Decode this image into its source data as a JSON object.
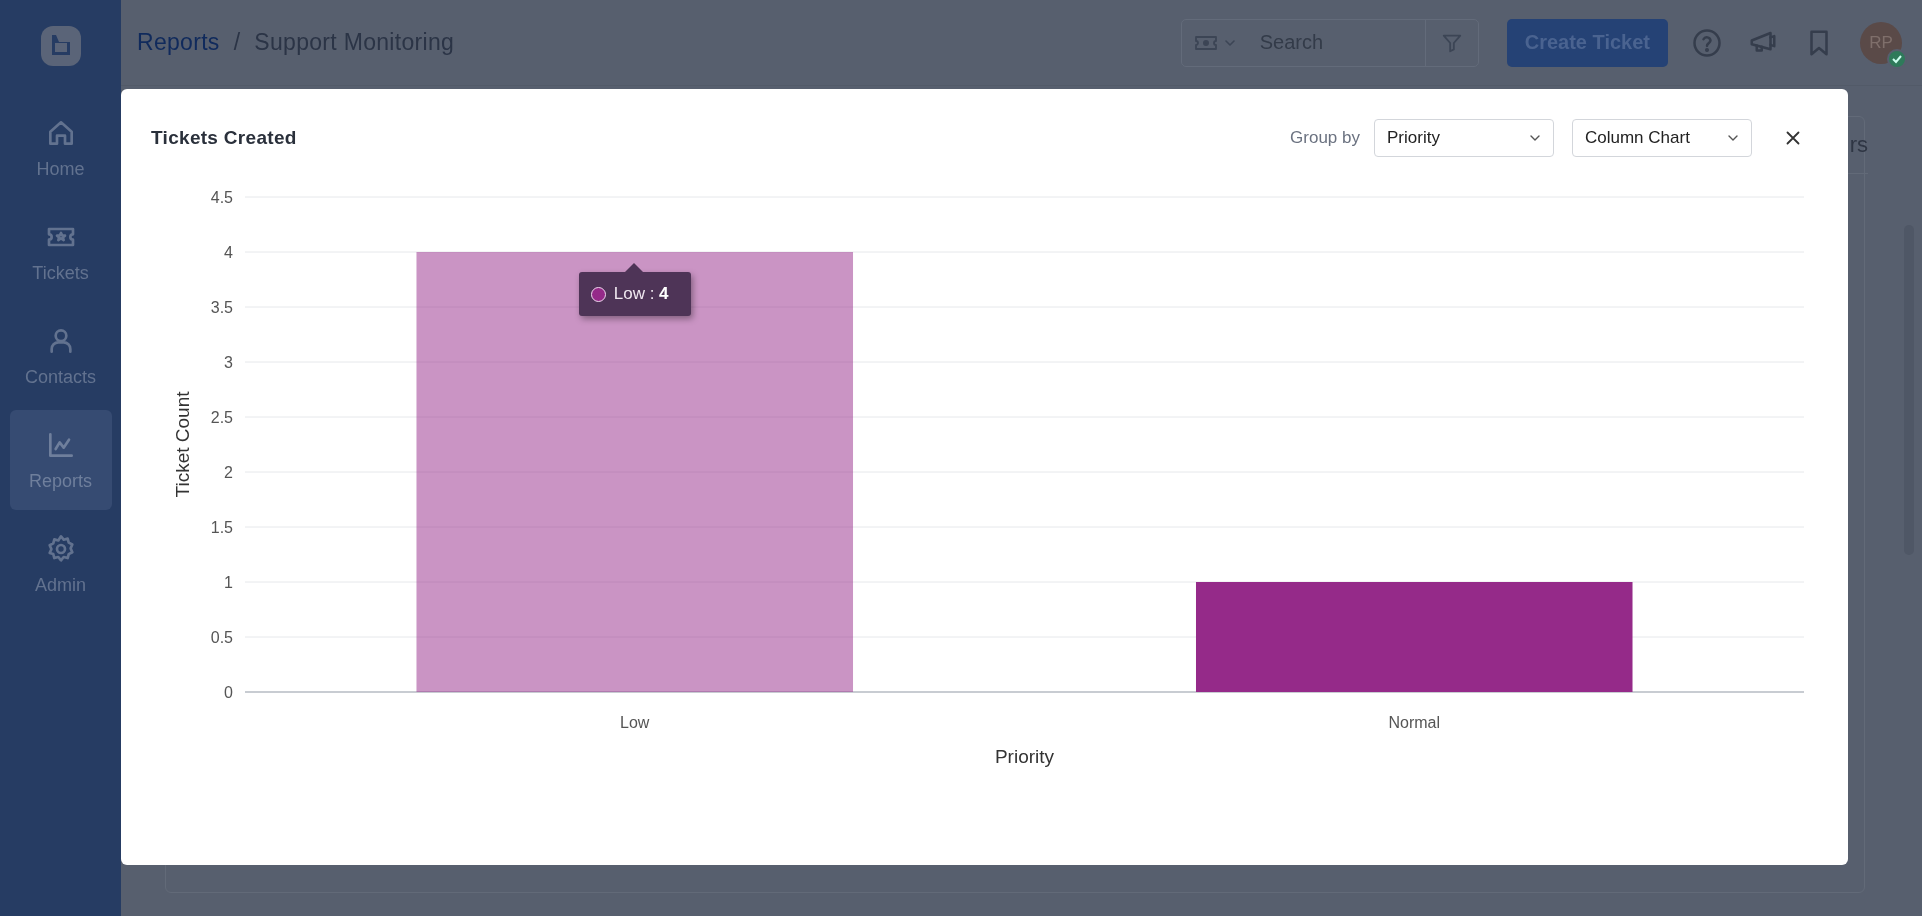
{
  "sidebar": {
    "items": [
      {
        "label": "Home",
        "selected": false
      },
      {
        "label": "Tickets",
        "selected": false
      },
      {
        "label": "Contacts",
        "selected": false
      },
      {
        "label": "Reports",
        "selected": true
      },
      {
        "label": "Admin",
        "selected": false
      }
    ]
  },
  "header": {
    "breadcrumb": [
      "Reports",
      "Support Monitoring"
    ],
    "breadcrumb_separator": "/",
    "search": {
      "placeholder": "Search"
    },
    "create_button": "Create Ticket",
    "avatar": {
      "initials": "RP",
      "online": true
    }
  },
  "background_panel": {
    "title_fragment": "rs"
  },
  "modal": {
    "title": "Tickets Created",
    "group_by_label": "Group by",
    "group_by": "Priority",
    "chart_type": "Column Chart",
    "chart_data": {
      "type": "bar",
      "orientation": "vertical",
      "xlabel": "Priority",
      "ylabel": "Ticket Count",
      "categories": [
        "Low",
        "Normal"
      ],
      "series": [
        {
          "color": "#952a89",
          "values": [
            4,
            1
          ]
        }
      ],
      "ylim": [
        0,
        4.5
      ],
      "yticks": [
        0,
        0.5,
        1,
        1.5,
        2,
        2.5,
        3,
        3.5,
        4,
        4.5
      ],
      "grid": true
    },
    "bars": [
      {
        "highlighted": true
      },
      {
        "highlighted": false
      }
    ],
    "tooltip": {
      "text": "Low : **4**"
    }
  }
}
